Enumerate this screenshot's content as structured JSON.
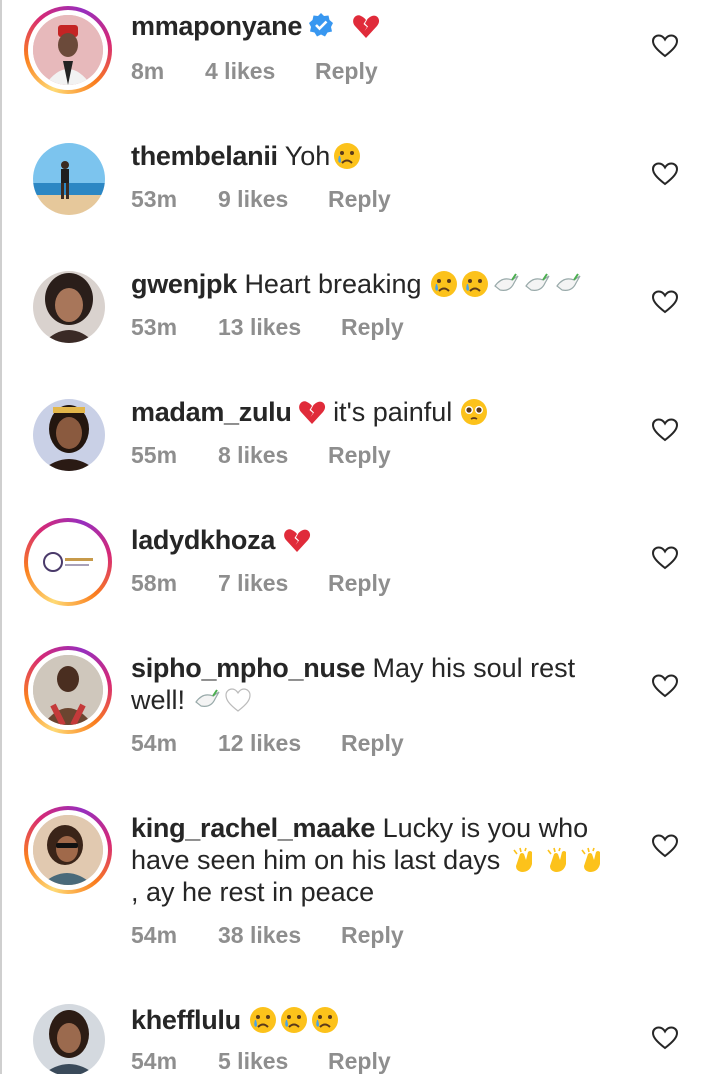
{
  "comments": [
    {
      "username": "mmaponyane",
      "text": "",
      "time": "8m",
      "likes": "4 likes",
      "reply": "Reply",
      "verified": true,
      "emojis": [
        "broken-heart"
      ]
    },
    {
      "username": "thembelanii",
      "text": "Yoh",
      "time": "53m",
      "likes": "9 likes",
      "reply": "Reply",
      "emojis": [
        "crying-face"
      ]
    },
    {
      "username": "gwenjpk",
      "text": "Heart breaking",
      "time": "53m",
      "likes": "13 likes",
      "reply": "Reply",
      "emojis": [
        "crying-face",
        "crying-face",
        "dove",
        "dove",
        "dove"
      ]
    },
    {
      "username": "madam_zulu",
      "text": "it's painful",
      "time": "55m",
      "likes": "8 likes",
      "reply": "Reply",
      "emojis_before_text": [
        "broken-heart"
      ],
      "emojis": [
        "pleading-face"
      ]
    },
    {
      "username": "ladydkhoza",
      "text": "",
      "time": "58m",
      "likes": "7 likes",
      "reply": "Reply",
      "emojis": [
        "broken-heart"
      ]
    },
    {
      "username": "sipho_mpho_nuse",
      "text": "May his soul rest well!",
      "time": "54m",
      "likes": "12 likes",
      "reply": "Reply",
      "emojis": [
        "dove",
        "white-heart"
      ]
    },
    {
      "username": "king_rachel_maake",
      "text": "Lucky is you who have seen him on his last days",
      "text_after_emojis": ", ay he rest in peace",
      "time": "54m",
      "likes": "38 likes",
      "reply": "Reply",
      "emojis": [
        "clapping-hands",
        "clapping-hands",
        "clapping-hands"
      ]
    },
    {
      "username": "khefflulu",
      "text": "",
      "time": "54m",
      "likes": "5 likes",
      "reply": "Reply",
      "emojis": [
        "crying-face",
        "crying-face",
        "crying-face"
      ]
    }
  ],
  "icons": {
    "like": "heart-outline-icon",
    "verified": "verified-badge-icon"
  },
  "colors": {
    "text": "#262626",
    "meta": "#8e8e8e",
    "verified": "#3897f0"
  }
}
